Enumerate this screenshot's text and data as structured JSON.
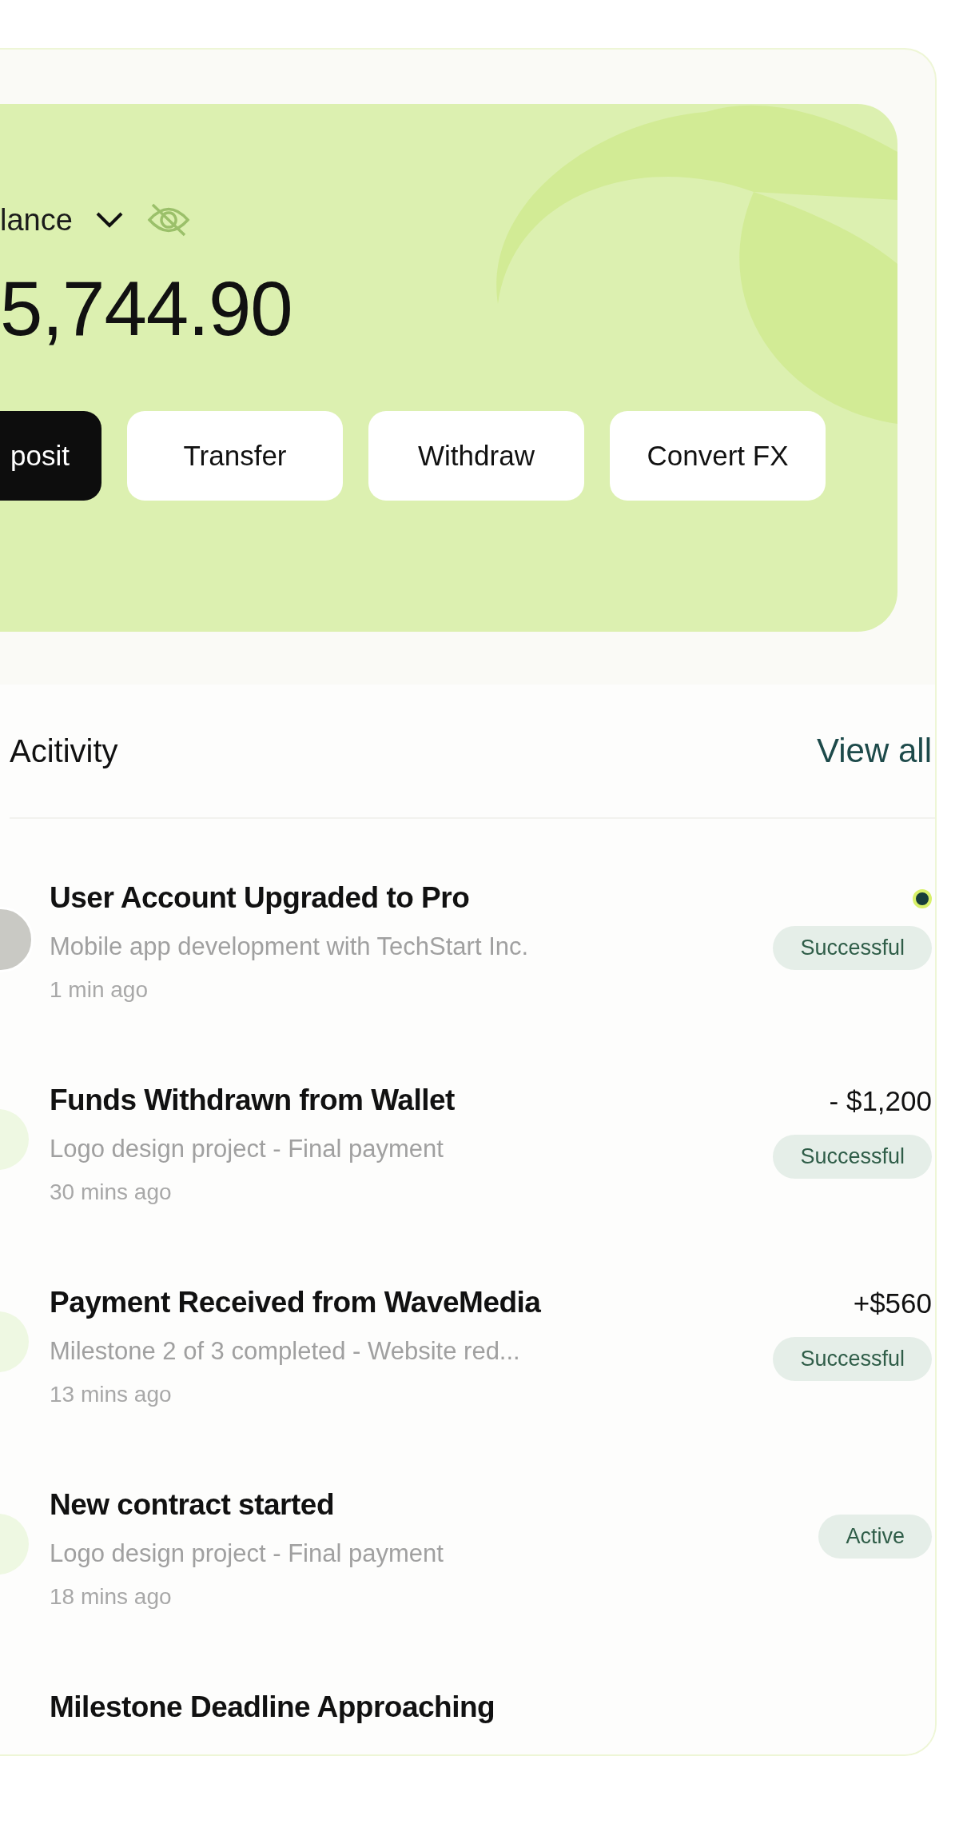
{
  "balance": {
    "label": "lance",
    "amount": "5,744.90"
  },
  "actions": [
    {
      "label": "posit",
      "primary": true
    },
    {
      "label": "Transfer",
      "primary": false
    },
    {
      "label": "Withdraw",
      "primary": false
    },
    {
      "label": "Convert FX",
      "primary": false
    }
  ],
  "activity": {
    "title": "Acitivity",
    "view_all": "View all",
    "items": [
      {
        "kind": "photo",
        "title": "User Account Upgraded to Pro",
        "description": "Mobile app development with TechStart Inc.",
        "time": "1 min ago",
        "unread": true,
        "status": "Successful"
      },
      {
        "kind": "icon",
        "title": "Funds Withdrawn from Wallet",
        "description": "Logo design project - Final payment",
        "time": "30 mins ago",
        "unread": false,
        "amount": "- $1,200",
        "status": "Successful"
      },
      {
        "kind": "icon",
        "title": "Payment Received from WaveMedia",
        "description": "Milestone 2 of 3 completed - Website red...",
        "time": "13 mins ago",
        "unread": false,
        "amount": "+$560",
        "status": "Successful"
      },
      {
        "kind": "icon",
        "title": "New contract started",
        "description": "Logo design project - Final payment",
        "time": "18 mins ago",
        "unread": false,
        "status": "Active"
      },
      {
        "kind": "none",
        "title": "Milestone Deadline Approaching"
      }
    ]
  }
}
